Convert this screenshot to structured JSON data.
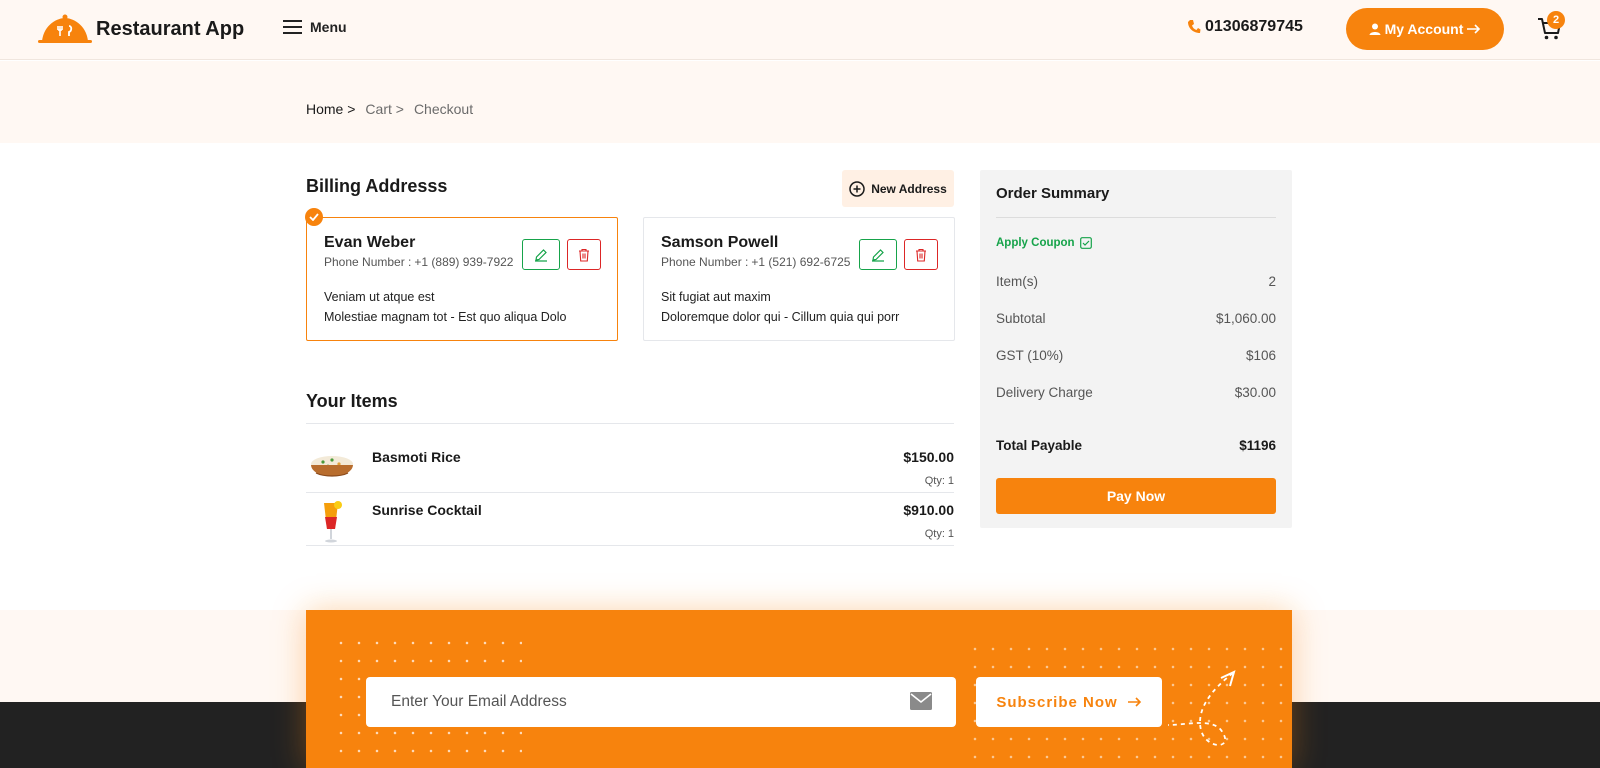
{
  "header": {
    "app_name": "Restaurant App",
    "menu_label": "Menu",
    "phone": "01306879745",
    "account_label": "My Account",
    "cart_count": "2"
  },
  "breadcrumb": {
    "home": "Home >",
    "cart": "Cart >",
    "current": "Checkout"
  },
  "billing": {
    "title": "Billing Addresss",
    "new_address_label": "New Address",
    "phone_prefix": "Phone Number :",
    "addresses": [
      {
        "name": "Evan Weber",
        "phone": "+1 (889) 939-7922",
        "line1": "Veniam ut atque est",
        "line2": "Molestiae magnam tot - Est quo aliqua Dolo",
        "selected": true
      },
      {
        "name": "Samson Powell",
        "phone": "+1 (521) 692-6725",
        "line1": "Sit fugiat aut maxim",
        "line2": "Doloremque dolor qui - Cillum quia qui porr",
        "selected": false
      }
    ]
  },
  "items": {
    "title": "Your Items",
    "qty_prefix": "Qty:",
    "list": [
      {
        "name": "Basmoti Rice",
        "price": "$150.00",
        "qty": "1"
      },
      {
        "name": "Sunrise Cocktail",
        "price": "$910.00",
        "qty": "1"
      }
    ]
  },
  "summary": {
    "title": "Order Summary",
    "coupon_label": "Apply Coupon",
    "rows": [
      {
        "label": "Item(s)",
        "value": "2"
      },
      {
        "label": "Subtotal",
        "value": "$1,060.00"
      },
      {
        "label": "GST (10%)",
        "value": "$106"
      },
      {
        "label": "Delivery Charge",
        "value": "$30.00"
      }
    ],
    "total_label": "Total Payable",
    "total_value": "$1196",
    "pay_label": "Pay Now"
  },
  "newsletter": {
    "placeholder": "Enter Your Email Address",
    "subscribe_label": "Subscribe Now"
  },
  "colors": {
    "accent": "#f7830d",
    "success": "#16a34a",
    "danger": "#dc2626",
    "header_bg": "#fff8f3",
    "footer_dark": "#222222"
  }
}
